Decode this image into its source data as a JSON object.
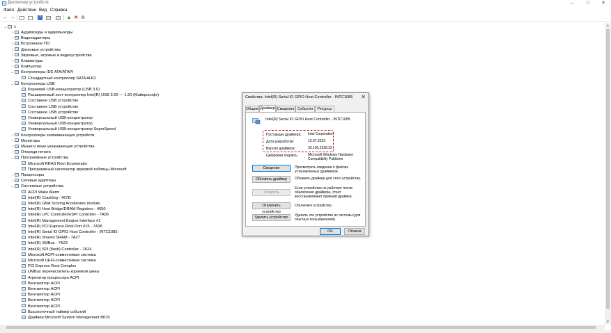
{
  "window": {
    "title": "Диспетчер устройств",
    "controls": {
      "minimize": "–",
      "maximize": "□",
      "close": "✕"
    }
  },
  "menu": [
    "Файл",
    "Действие",
    "Вид",
    "Справка"
  ],
  "toolbar_icons": [
    "back-arrow-icon",
    "forward-arrow-icon",
    "properties-icon",
    "view-icon",
    "help-icon",
    "monitor-icon",
    "update-driver-icon",
    "uninstall-icon",
    "scan-hardware-icon"
  ],
  "tree": {
    "root": "1",
    "rows": [
      {
        "level": 1,
        "arrow": "›",
        "label": "Аудиовходы и аудиовыходы"
      },
      {
        "level": 1,
        "arrow": "›",
        "label": "Видеоадаптеры"
      },
      {
        "level": 1,
        "arrow": "›",
        "label": "Встроенное ПО"
      },
      {
        "level": 1,
        "arrow": "›",
        "label": "Дисковые устройства"
      },
      {
        "level": 1,
        "arrow": "›",
        "label": "Звуковые, игровые и видеоустройства"
      },
      {
        "level": 1,
        "arrow": "›",
        "label": "Клавиатуры"
      },
      {
        "level": 1,
        "arrow": "›",
        "label": "Компьютер"
      },
      {
        "level": 1,
        "arrow": "⌄",
        "label": "Контроллеры IDE ATA/ATAPI"
      },
      {
        "level": 2,
        "arrow": "",
        "label": "Стандартный контроллер SATA AHCI"
      },
      {
        "level": 1,
        "arrow": "⌄",
        "label": "Контроллеры USB"
      },
      {
        "level": 2,
        "arrow": "",
        "label": "Корневой USB-концентратор (USB 3.0)"
      },
      {
        "level": 2,
        "arrow": "",
        "label": "Расширяемый хост-контроллер Intel(R) USB 3.20 — 1.20 (Майкрософт)"
      },
      {
        "level": 2,
        "arrow": "",
        "label": "Составное USB устройство"
      },
      {
        "level": 2,
        "arrow": "",
        "label": "Составное USB устройство"
      },
      {
        "level": 2,
        "arrow": "",
        "label": "Составное USB устройство"
      },
      {
        "level": 2,
        "arrow": "",
        "label": "Универсальный USB-концентратор"
      },
      {
        "level": 2,
        "arrow": "",
        "label": "Универсальный USB-концентратор"
      },
      {
        "level": 2,
        "arrow": "",
        "label": "Универсальный USB-концентратор SuperSpeed"
      },
      {
        "level": 1,
        "arrow": "›",
        "label": "Контроллеры запоминающих устройств"
      },
      {
        "level": 1,
        "arrow": "›",
        "label": "Мониторы"
      },
      {
        "level": 1,
        "arrow": "›",
        "label": "Мыши и иные указывающие устройства"
      },
      {
        "level": 1,
        "arrow": "›",
        "label": "Очереди печати"
      },
      {
        "level": 1,
        "arrow": "⌄",
        "label": "Программные устройства"
      },
      {
        "level": 2,
        "arrow": "",
        "label": "Microsoft RRAS Root Enumerator"
      },
      {
        "level": 2,
        "arrow": "",
        "label": "Программный синтезатор звуковой таблицы Microsoft"
      },
      {
        "level": 1,
        "arrow": "›",
        "label": "Процессоры"
      },
      {
        "level": 1,
        "arrow": "›",
        "label": "Сетевые адаптеры"
      },
      {
        "level": 1,
        "arrow": "⌄",
        "label": "Системные устройства"
      },
      {
        "level": 2,
        "arrow": "",
        "label": "ACPI Wake Alarm"
      },
      {
        "level": 2,
        "arrow": "",
        "label": "Intel(R) Crashlog - 467D"
      },
      {
        "level": 2,
        "arrow": "",
        "label": "Intel(R) GNA Scoring Accelerator module"
      },
      {
        "level": 2,
        "arrow": "",
        "label": "Intel(R) Host Bridge/DRAM Registers - 4650"
      },
      {
        "level": 2,
        "arrow": "",
        "label": "Intel(R) LPC Controller/eSPI Controller - 7A06"
      },
      {
        "level": 2,
        "arrow": "",
        "label": "Intel(R) Management Engine Interface #1"
      },
      {
        "level": 2,
        "arrow": "",
        "label": "Intel(R) PCI Express Root Port #15 - 7A36"
      },
      {
        "level": 2,
        "arrow": "",
        "label": "Intel(R) Serial IO GPIO Host Controller - INTC1085"
      },
      {
        "level": 2,
        "arrow": "",
        "label": "Intel(R) Shared SRAM - 7A27"
      },
      {
        "level": 2,
        "arrow": "",
        "label": "Intel(R) SMBus - 7A23"
      },
      {
        "level": 2,
        "arrow": "",
        "label": "Intel(R) SPI (flash) Controller - 7A24"
      },
      {
        "level": 2,
        "arrow": "",
        "label": "Microsoft ACPI-совместимая система"
      },
      {
        "level": 2,
        "arrow": "",
        "label": "Microsoft UEFI-совместимая система"
      },
      {
        "level": 2,
        "arrow": "",
        "label": "PCI Express Root Complex"
      },
      {
        "level": 2,
        "arrow": "",
        "label": "UMBus перечислитель корневой шины"
      },
      {
        "level": 2,
        "arrow": "",
        "label": "Агрегатор процессора ACPI"
      },
      {
        "level": 2,
        "arrow": "",
        "label": "Вентилятор ACPI"
      },
      {
        "level": 2,
        "arrow": "",
        "label": "Вентилятор ACPI"
      },
      {
        "level": 2,
        "arrow": "",
        "label": "Вентилятор ACPI"
      },
      {
        "level": 2,
        "arrow": "",
        "label": "Вентилятор ACPI"
      },
      {
        "level": 2,
        "arrow": "",
        "label": "Вентилятор ACPI"
      },
      {
        "level": 2,
        "arrow": "",
        "label": "Высокоточный таймер событий"
      },
      {
        "level": 2,
        "arrow": "",
        "label": "Драйвер Microsoft System Management BIOS"
      }
    ]
  },
  "dialog": {
    "title": "Свойства: Intel(R) Serial IO GPIO Host Controller - INTC1085",
    "close": "✕",
    "tabs": [
      "Общие",
      "Драйвер",
      "Сведения",
      "События",
      "Ресурсы"
    ],
    "active_tab": 1,
    "device_name": "Intel(R) Serial IO GPIO Host Controller - INTC1085",
    "props": [
      {
        "label": "Поставщик драйвера:",
        "value": "Intel Corporation"
      },
      {
        "label": "Дата разработки:",
        "value": "13.07.2023"
      },
      {
        "label": "Версия драйвера:",
        "value": "30.100.2328.32"
      },
      {
        "label": "Цифровая подпись:",
        "value": "Microsoft Windows Hardware Compatibility Publisher"
      }
    ],
    "actions": [
      {
        "button": "Сведения",
        "desc": "Просмотреть сведения о файлах установленных драйверов.",
        "default": true,
        "disabled": false
      },
      {
        "button": "Обновить драйвер",
        "desc": "Обновить драйвер для этого устройства.",
        "default": false,
        "disabled": false
      },
      {
        "button": "Откатить",
        "desc": "Если устройство не работает после обновления драйвера, откат восстанавливает прежний драйвер.",
        "default": false,
        "disabled": true
      },
      {
        "button": "Отключить устройство",
        "desc": "Отключите устройство.",
        "default": false,
        "disabled": false
      },
      {
        "button": "Удалить устройство",
        "desc": "Удалить это устройство из системы (для опытных пользователей).",
        "default": false,
        "disabled": false
      }
    ],
    "ok": "OK",
    "cancel": "Отмена"
  }
}
